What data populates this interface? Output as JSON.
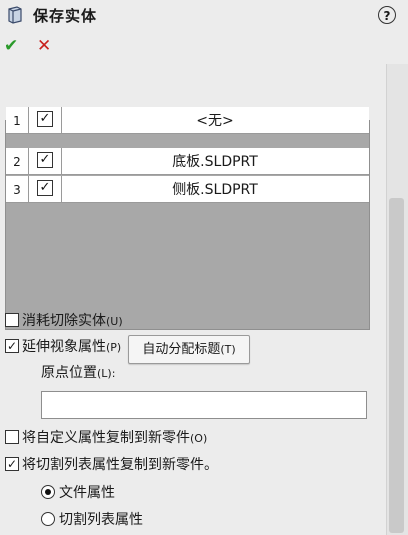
{
  "window": {
    "title": "保存实体",
    "help_glyph": "?",
    "ok_glyph": "✔",
    "cancel_glyph": "✕"
  },
  "grid": {
    "rows": [
      {
        "num": "1",
        "checked": true,
        "name": "<无>"
      },
      {
        "num": "2",
        "checked": true,
        "name": "底板.SLDPRT"
      },
      {
        "num": "3",
        "checked": true,
        "name": "侧板.SLDPRT"
      }
    ]
  },
  "buttons": {
    "auto_assign_main": "自动分配标题",
    "auto_assign_shortcut": "(T)"
  },
  "options": {
    "consume_cut": {
      "label": "消耗切除实体",
      "shortcut": "(U)",
      "checked": false
    },
    "propagate_visual": {
      "label": "延伸视象属性",
      "shortcut": "(P)",
      "checked": true
    },
    "origin_label": "原点位置",
    "origin_shortcut": "(L):",
    "origin_value": "",
    "copy_custom_props": {
      "label": "将自定义属性复制到新零件",
      "shortcut": "(O)",
      "checked": false
    },
    "copy_cutlist_props": {
      "label": "将切割列表属性复制到新零件。",
      "checked": true
    },
    "radio_file_props": {
      "label": "文件属性",
      "selected": true
    },
    "radio_cutlist_props": {
      "label": "切割列表属性",
      "selected": false
    }
  },
  "colors": {
    "ok_green": "#2a9a2a",
    "cancel_red": "#c8201c",
    "grid_empty": "#a8a8a8",
    "panel_bg": "#ececec"
  },
  "icons": {
    "title": "save-bodies-icon",
    "help": "help-icon",
    "ok": "checkmark-icon",
    "cancel": "close-icon"
  }
}
